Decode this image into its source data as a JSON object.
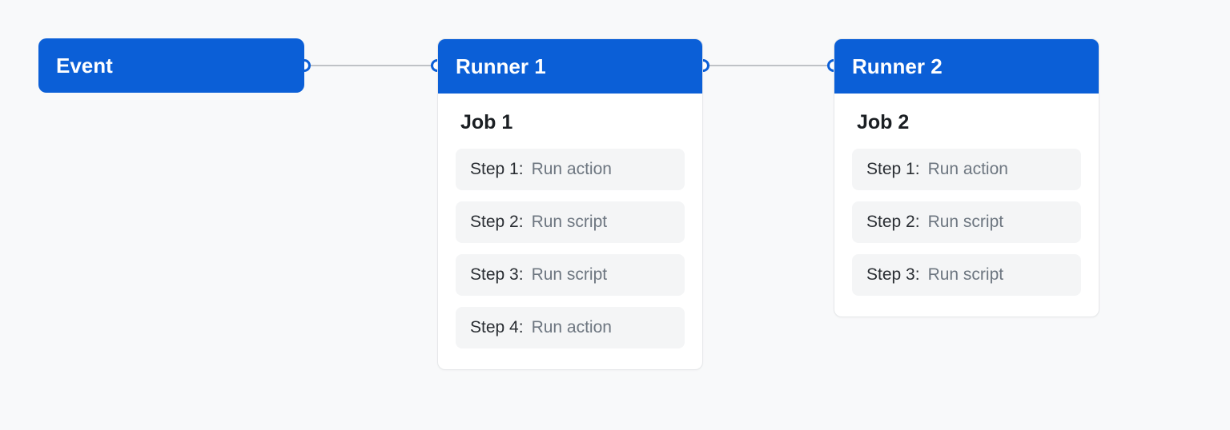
{
  "event": {
    "label": "Event"
  },
  "runner1": {
    "header": "Runner 1",
    "job": "Job 1",
    "steps": [
      {
        "label": "Step 1:",
        "desc": "Run action"
      },
      {
        "label": "Step 2:",
        "desc": "Run script"
      },
      {
        "label": "Step 3:",
        "desc": "Run script"
      },
      {
        "label": "Step 4:",
        "desc": "Run action"
      }
    ]
  },
  "runner2": {
    "header": "Runner 2",
    "job": "Job 2",
    "steps": [
      {
        "label": "Step 1:",
        "desc": "Run action"
      },
      {
        "label": "Step 2:",
        "desc": "Run script"
      },
      {
        "label": "Step 3:",
        "desc": "Run script"
      }
    ]
  }
}
